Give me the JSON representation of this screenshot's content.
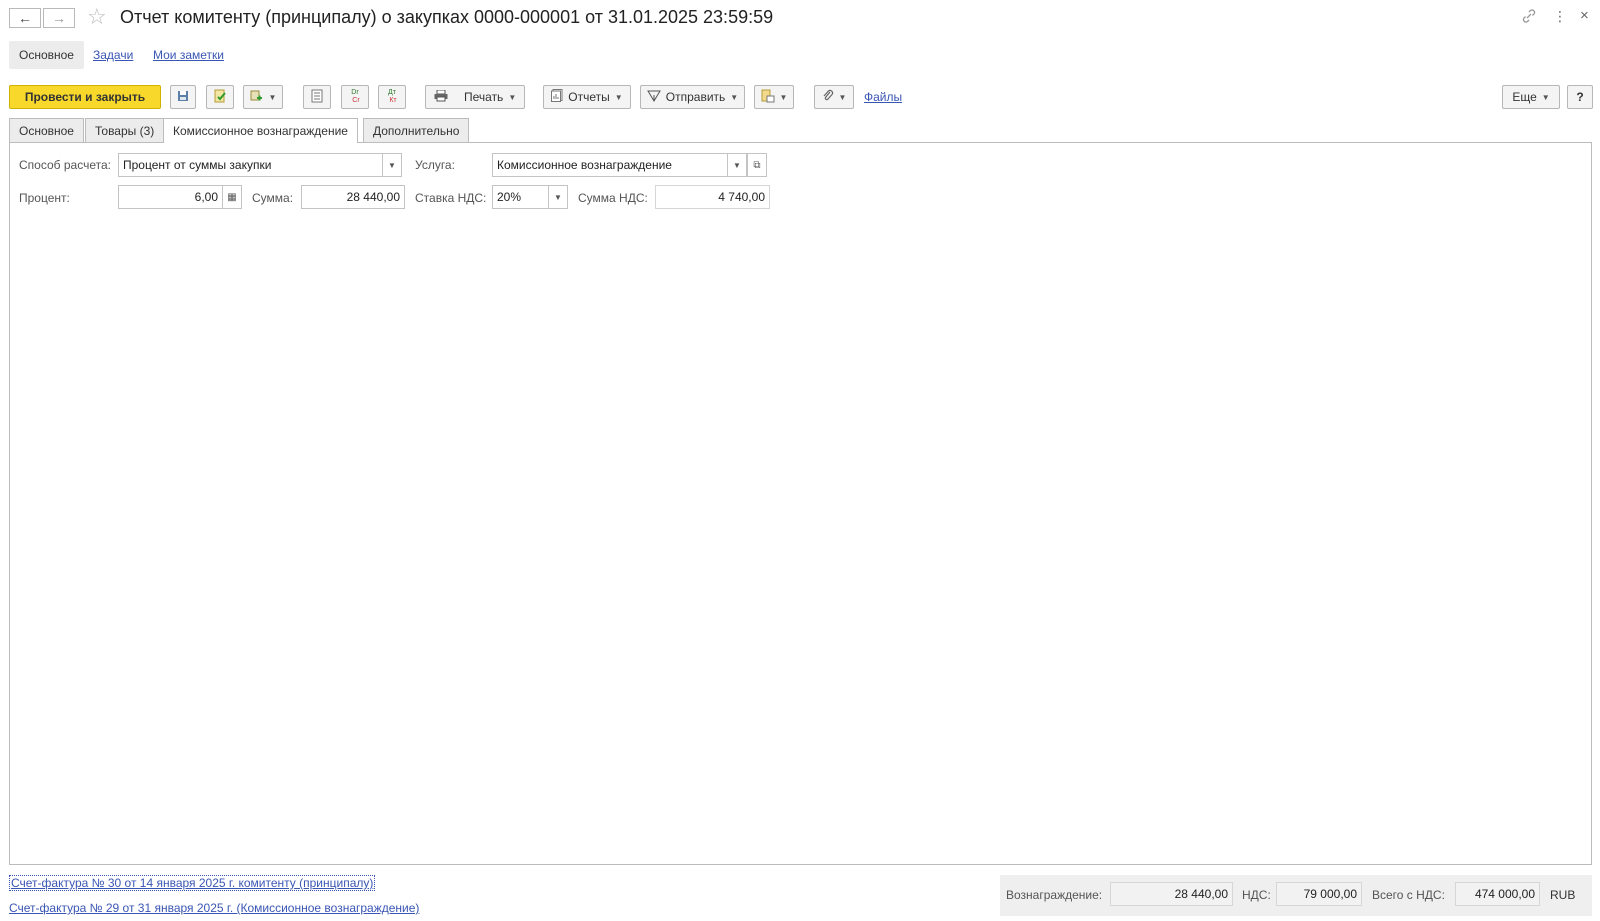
{
  "window": {
    "title": "Отчет комитенту (принципалу) о закупках 0000-000001 от 31.01.2025 23:59:59",
    "back_icon": "←",
    "forward_icon": "→",
    "star_icon": "☆",
    "link_icon": "🔗",
    "more_icon": "⋮",
    "close_icon": "×"
  },
  "sections": {
    "main": "Основное",
    "tasks": "Задачи",
    "notes": "Мои заметки"
  },
  "toolbar": {
    "post_close": "Провести и закрыть",
    "print": "Печать",
    "reports": "Отчеты",
    "send": "Отправить",
    "files": "Файлы",
    "more": "Еще",
    "help": "?",
    "dtct_label": "Dr Cr",
    "atkt_label": "Дт Кт"
  },
  "tabs": [
    "Основное",
    "Товары (3)",
    "Комиссионное вознаграждение",
    "Дополнительно"
  ],
  "form": {
    "calc_method_label": "Способ расчета:",
    "calc_method_value": "Процент от суммы закупки",
    "service_label": "Услуга:",
    "service_value": "Комиссионное вознаграждение",
    "percent_label": "Процент:",
    "percent_value": "6,00",
    "sum_label": "Сумма:",
    "sum_value": "28 440,00",
    "vat_rate_label": "Ставка НДС:",
    "vat_rate_value": "20%",
    "vat_sum_label": "Сумма НДС:",
    "vat_sum_value": "4 740,00"
  },
  "footer": {
    "link1": "Счет-фактура № 30 от 14 января 2025 г. комитенту (принципалу)",
    "link2": "Счет-фактура № 29 от 31 января 2025 г. (Комиссионное вознаграждение)",
    "reward_label": "Вознаграждение:",
    "reward_value": "28 440,00",
    "vat_label": "НДС:",
    "vat_value": "79 000,00",
    "total_label": "Всего с НДС:",
    "total_value": "474 000,00",
    "currency": "RUB"
  }
}
